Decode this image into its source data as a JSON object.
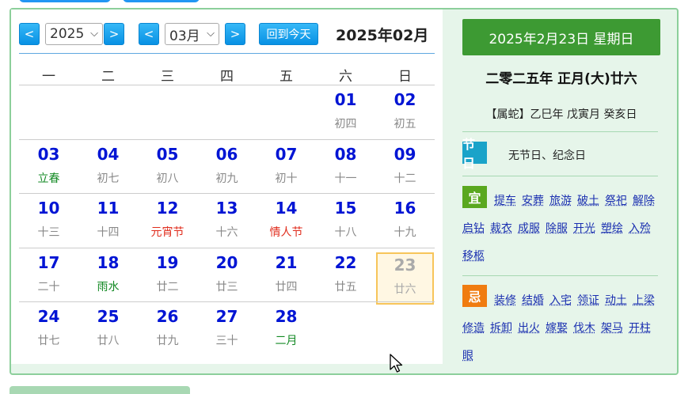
{
  "toolbar": {
    "prev_year": "<",
    "next_year": ">",
    "year": "2025",
    "prev_month": "<",
    "next_month": ">",
    "month": "03月",
    "today_label": "回到今天",
    "title": "2025年02月",
    "chevron_icon": "chevron-down-icon"
  },
  "weekdays": [
    "一",
    "二",
    "三",
    "四",
    "五",
    "六",
    "日"
  ],
  "days": [
    {
      "num": "01",
      "sub": "初四",
      "kind": "lunar"
    },
    {
      "num": "02",
      "sub": "初五",
      "kind": "lunar"
    },
    {
      "num": "03",
      "sub": "立春",
      "kind": "term"
    },
    {
      "num": "04",
      "sub": "初七",
      "kind": "lunar"
    },
    {
      "num": "05",
      "sub": "初八",
      "kind": "lunar"
    },
    {
      "num": "06",
      "sub": "初九",
      "kind": "lunar"
    },
    {
      "num": "07",
      "sub": "初十",
      "kind": "lunar"
    },
    {
      "num": "08",
      "sub": "十一",
      "kind": "lunar"
    },
    {
      "num": "09",
      "sub": "十二",
      "kind": "lunar"
    },
    {
      "num": "10",
      "sub": "十三",
      "kind": "lunar"
    },
    {
      "num": "11",
      "sub": "十四",
      "kind": "lunar"
    },
    {
      "num": "12",
      "sub": "元宵节",
      "kind": "fest"
    },
    {
      "num": "13",
      "sub": "十六",
      "kind": "lunar"
    },
    {
      "num": "14",
      "sub": "情人节",
      "kind": "fest"
    },
    {
      "num": "15",
      "sub": "十八",
      "kind": "lunar"
    },
    {
      "num": "16",
      "sub": "十九",
      "kind": "lunar"
    },
    {
      "num": "17",
      "sub": "二十",
      "kind": "lunar"
    },
    {
      "num": "18",
      "sub": "雨水",
      "kind": "term"
    },
    {
      "num": "19",
      "sub": "廿二",
      "kind": "lunar"
    },
    {
      "num": "20",
      "sub": "廿三",
      "kind": "lunar"
    },
    {
      "num": "21",
      "sub": "廿四",
      "kind": "lunar"
    },
    {
      "num": "22",
      "sub": "廿五",
      "kind": "lunar"
    },
    {
      "num": "23",
      "sub": "廿六",
      "kind": "selected"
    },
    {
      "num": "24",
      "sub": "廿七",
      "kind": "lunar"
    },
    {
      "num": "25",
      "sub": "廿八",
      "kind": "lunar"
    },
    {
      "num": "26",
      "sub": "廿九",
      "kind": "lunar"
    },
    {
      "num": "27",
      "sub": "三十",
      "kind": "lunar"
    },
    {
      "num": "28",
      "sub": "二月",
      "kind": "term"
    }
  ],
  "panel": {
    "date": "2025年2月23日 星期日",
    "lunar": "二零二五年 正月(大)廿六",
    "ganzhi": "【属蛇】乙巳年 戊寅月 癸亥日",
    "festival_badge": "节日",
    "festival_text": "无节日、纪念日",
    "yi_badge": "宜",
    "yi_items": [
      "提车",
      "安葬",
      "旅游",
      "破土",
      "祭祀",
      "解除",
      "启钻",
      "裁衣",
      "成服",
      "除服",
      "开光",
      "塑绘",
      "入殓",
      "移柩"
    ],
    "ji_badge": "忌",
    "ji_items": [
      "装修",
      "结婚",
      "入宅",
      "领证",
      "动土",
      "上梁",
      "修造",
      "拆卸",
      "出火",
      "嫁娶",
      "伐木",
      "架马",
      "开柱",
      "眼"
    ],
    "colors": {
      "festival": "#1aa3c9",
      "yi": "#5aa81f",
      "ji": "#f07c10"
    }
  }
}
